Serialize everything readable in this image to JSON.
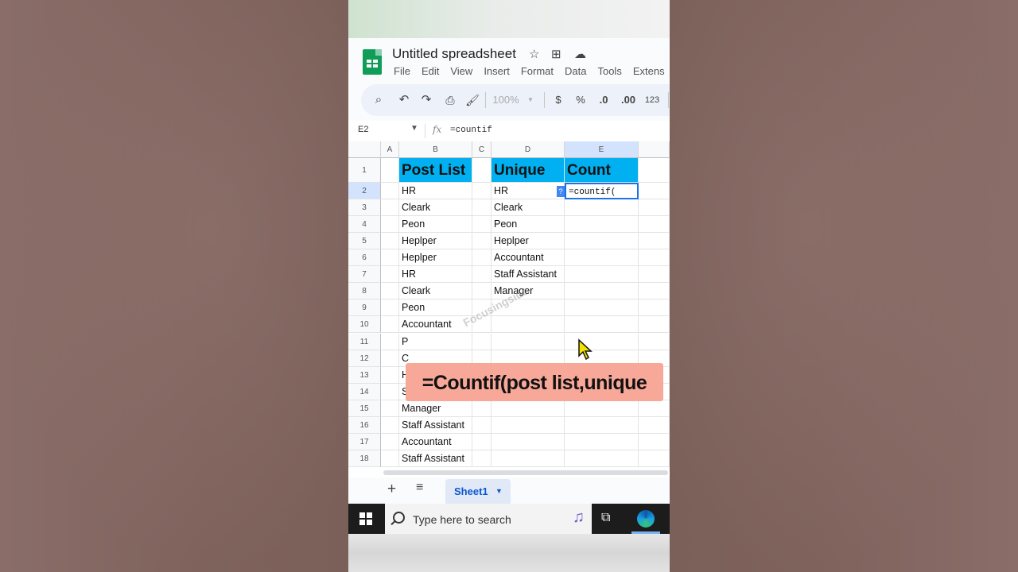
{
  "app": {
    "doc_title": "Untitled spreadsheet",
    "menu": [
      "File",
      "Edit",
      "View",
      "Insert",
      "Format",
      "Data",
      "Tools",
      "Extens"
    ]
  },
  "toolbar": {
    "zoom": "100%",
    "currency": "$",
    "percent": "%",
    "decrease_decimal": ".0",
    "increase_decimal": ".00",
    "number_format": "123"
  },
  "formula_bar": {
    "name_box": "E2",
    "fx": "fx",
    "formula": "=countif"
  },
  "grid": {
    "columns": [
      "A",
      "B",
      "C",
      "D",
      "E"
    ],
    "rows": [
      "1",
      "2",
      "3",
      "4",
      "5",
      "6",
      "7",
      "8",
      "9",
      "10",
      "11",
      "12",
      "13",
      "14",
      "15",
      "16",
      "17",
      "18"
    ],
    "headers": {
      "post_list": "Post List",
      "unique": "Unique",
      "count": "Count"
    },
    "post_list": [
      "HR",
      "Cleark",
      "Peon",
      "Heplper",
      "Heplper",
      "HR",
      "Cleark",
      "Peon",
      "Accountant",
      "P",
      "C",
      "Heplper",
      "Staff Assistant",
      "Manager",
      "Staff Assistant",
      "Accountant",
      "Staff Assistant"
    ],
    "unique": [
      "HR",
      "Cleark",
      "Peon",
      "Heplper",
      "Accountant",
      "Staff Assistant",
      "Manager"
    ],
    "active_cell_text": "=countif(",
    "fill_badge": "?"
  },
  "overlay": {
    "watermark": "Focusingside",
    "caption": "=Countif(post list,unique"
  },
  "sheets": {
    "add": "+",
    "all": "≡",
    "active_tab": "Sheet1"
  },
  "taskbar": {
    "search_placeholder": "Type here to search"
  },
  "colors": {
    "header_fill": "#00b0f0",
    "caption_bg": "#f8a899",
    "selection": "#1a73e8",
    "sheets_green": "#0f9d58"
  }
}
